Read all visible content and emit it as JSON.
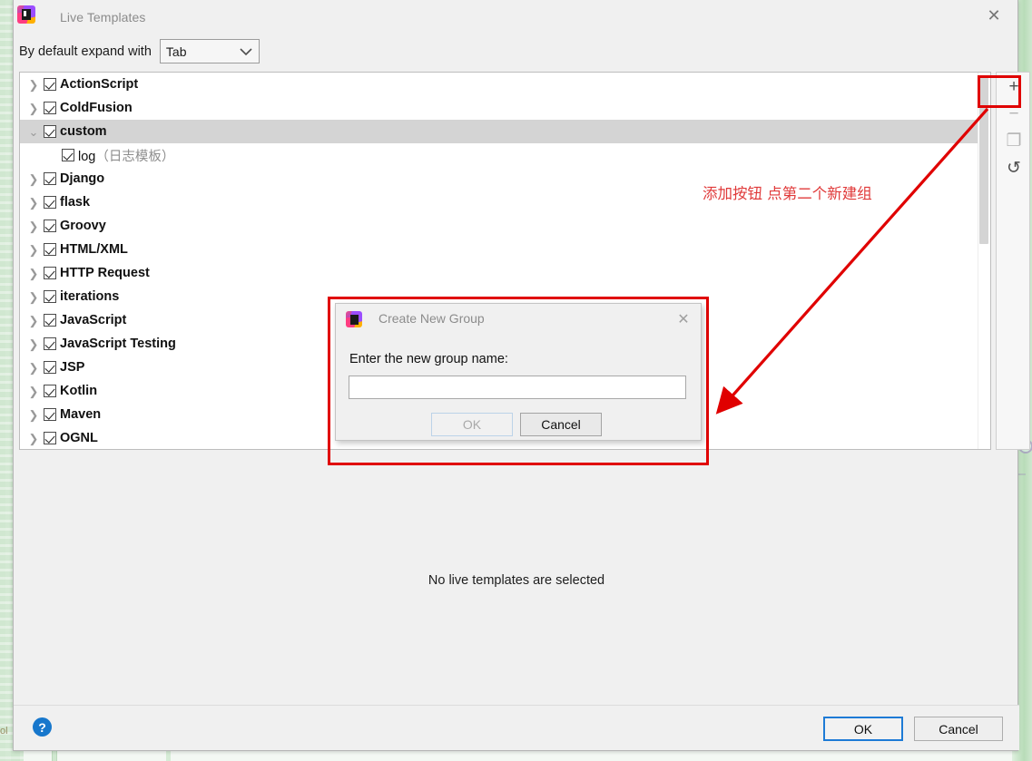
{
  "window": {
    "title": "Live Templates",
    "icon": "intellij-app-icon",
    "close_icon": "close-icon"
  },
  "expand": {
    "label": "By default expand with",
    "selected": "Tab",
    "chevron": "chevron-down-icon"
  },
  "tree": {
    "items": [
      {
        "label": "ActionScript",
        "checked": true,
        "expandable": true,
        "expanded": false,
        "selected": false,
        "child": false
      },
      {
        "label": "ColdFusion",
        "checked": true,
        "expandable": true,
        "expanded": false,
        "selected": false,
        "child": false
      },
      {
        "label": "custom",
        "checked": true,
        "expandable": true,
        "expanded": true,
        "selected": true,
        "child": false
      },
      {
        "label": "log",
        "desc": "（日志模板）",
        "checked": true,
        "expandable": false,
        "expanded": false,
        "selected": false,
        "child": true
      },
      {
        "label": "Django",
        "checked": true,
        "expandable": true,
        "expanded": false,
        "selected": false,
        "child": false
      },
      {
        "label": "flask",
        "checked": true,
        "expandable": true,
        "expanded": false,
        "selected": false,
        "child": false
      },
      {
        "label": "Groovy",
        "checked": true,
        "expandable": true,
        "expanded": false,
        "selected": false,
        "child": false
      },
      {
        "label": "HTML/XML",
        "checked": true,
        "expandable": true,
        "expanded": false,
        "selected": false,
        "child": false
      },
      {
        "label": "HTTP Request",
        "checked": true,
        "expandable": true,
        "expanded": false,
        "selected": false,
        "child": false
      },
      {
        "label": "iterations",
        "checked": true,
        "expandable": true,
        "expanded": false,
        "selected": false,
        "child": false
      },
      {
        "label": "JavaScript",
        "checked": true,
        "expandable": true,
        "expanded": false,
        "selected": false,
        "child": false
      },
      {
        "label": "JavaScript Testing",
        "checked": true,
        "expandable": true,
        "expanded": false,
        "selected": false,
        "child": false
      },
      {
        "label": "JSP",
        "checked": true,
        "expandable": true,
        "expanded": false,
        "selected": false,
        "child": false
      },
      {
        "label": "Kotlin",
        "checked": true,
        "expandable": true,
        "expanded": false,
        "selected": false,
        "child": false
      },
      {
        "label": "Maven",
        "checked": true,
        "expandable": true,
        "expanded": false,
        "selected": false,
        "child": false
      },
      {
        "label": "OGNL",
        "checked": true,
        "expandable": true,
        "expanded": false,
        "selected": false,
        "child": false
      }
    ]
  },
  "side_toolbar": {
    "buttons": [
      {
        "name": "add-button",
        "glyph": "+",
        "enabled": true,
        "icon": "plus-icon"
      },
      {
        "name": "remove-button",
        "glyph": "−",
        "enabled": false,
        "icon": "minus-icon"
      },
      {
        "name": "duplicate-button",
        "glyph": "❐",
        "enabled": false,
        "icon": "copy-icon"
      },
      {
        "name": "revert-button",
        "glyph": "↺",
        "enabled": true,
        "icon": "undo-arrow-icon"
      }
    ]
  },
  "annotation": {
    "text": "添加按钮  点第二个新建组",
    "color": "#e03a3a"
  },
  "main": {
    "empty_message": "No live templates are selected"
  },
  "bottom": {
    "help_glyph": "?",
    "ok_label": "OK",
    "cancel_label": "Cancel"
  },
  "dialog": {
    "title": "Create New Group",
    "icon": "intellij-app-icon",
    "close_icon": "close-icon",
    "prompt": "Enter the new group name:",
    "input_value": "",
    "input_placeholder": "",
    "ok_label": "OK",
    "ok_enabled": false,
    "cancel_label": "Cancel"
  },
  "background": {
    "left_edge_text": "ol"
  }
}
